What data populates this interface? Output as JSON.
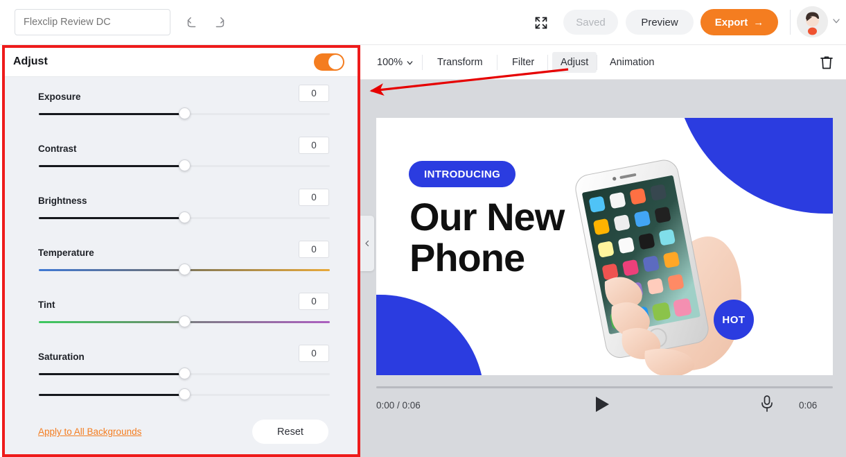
{
  "topbar": {
    "project_name_placeholder": "Flexclip Review DC",
    "project_name_value": "",
    "undo_icon": "undo-icon",
    "redo_icon": "redo-icon",
    "fullscreen_icon": "fullscreen-icon",
    "saved_label": "Saved",
    "preview_label": "Preview",
    "export_label": "Export",
    "export_arrow": "→",
    "avatar_icon": "user-avatar",
    "avatar_chevron_icon": "chevron-down-icon",
    "accent_color": "#f47d20"
  },
  "tabbar": {
    "zoom_level": "100%",
    "zoom_chevron_icon": "chevron-down-icon",
    "tabs": [
      {
        "label": "Transform",
        "active": false
      },
      {
        "label": "Filter",
        "active": false
      },
      {
        "label": "Adjust",
        "active": true
      },
      {
        "label": "Animation",
        "active": false
      }
    ],
    "delete_icon": "trash-icon"
  },
  "panel": {
    "title": "Adjust",
    "enabled": true,
    "toggle_icon": "toggle-switch-on",
    "sliders": [
      {
        "label": "Exposure",
        "value": "0",
        "track": "plain",
        "fill": true,
        "pos": 50
      },
      {
        "label": "Contrast",
        "value": "0",
        "track": "plain",
        "fill": true,
        "pos": 50
      },
      {
        "label": "Brightness",
        "value": "0",
        "track": "plain",
        "fill": true,
        "pos": 50
      },
      {
        "label": "Temperature",
        "value": "0",
        "track": "grad-temp",
        "fill": false,
        "pos": 50
      },
      {
        "label": "Tint",
        "value": "0",
        "track": "grad-tint",
        "fill": false,
        "pos": 50
      },
      {
        "label": "Saturation",
        "value": "0",
        "track": "plain",
        "fill": true,
        "pos": 50
      }
    ],
    "partial_slider": {
      "label": "",
      "value": "",
      "track": "plain",
      "fill": true,
      "pos": 50
    },
    "apply_all_label": "Apply to All Backgrounds",
    "reset_label": "Reset"
  },
  "canvas": {
    "collapse_icon": "chevron-left-icon",
    "badge_introducing": "INTRODUCING",
    "headline_line1": "Our New",
    "headline_line2": "Phone",
    "badge_hot": "HOT",
    "brand_blue": "#2b3ce0",
    "photo_alt": "hand-holding-white-smartphone"
  },
  "playback": {
    "current_and_total": "0:00 / 0:06",
    "play_icon": "play-icon",
    "mic_icon": "microphone-icon",
    "total_time": "0:06",
    "progress_percent": 0
  },
  "annotation": {
    "highlight_color": "#ee1b1b",
    "arrow_from": "Adjust tab",
    "arrow_to": "Adjust panel"
  }
}
